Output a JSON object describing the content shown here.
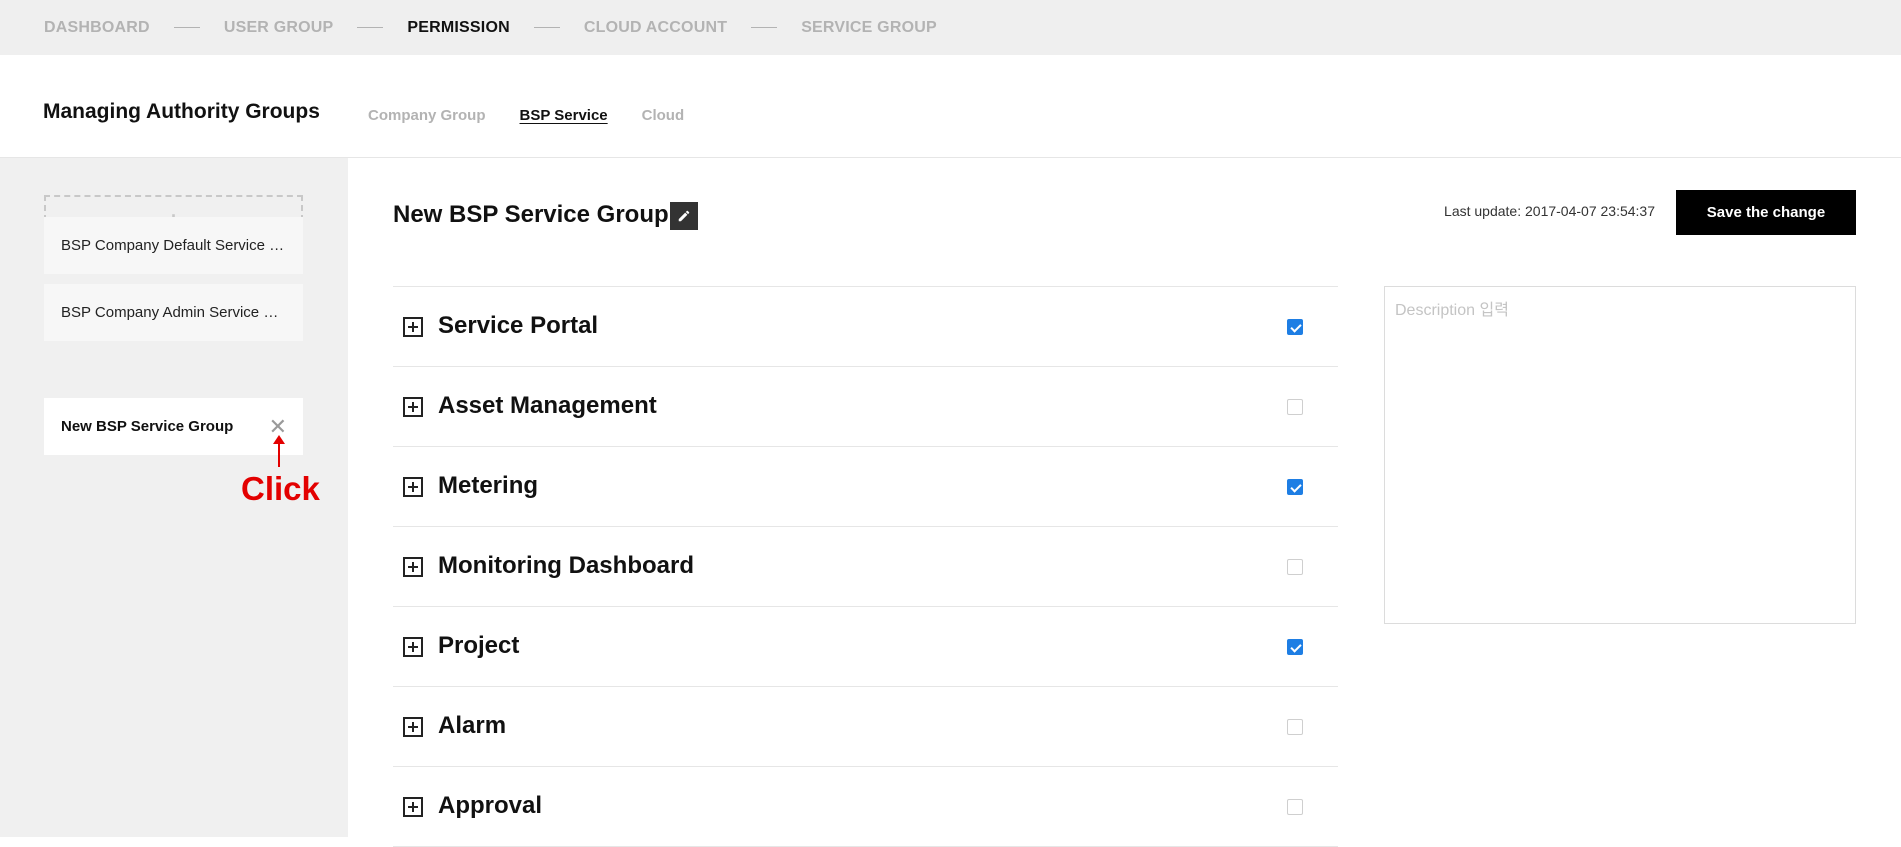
{
  "topnav": {
    "steps": [
      "DASHBOARD",
      "USER GROUP",
      "PERMISSION",
      "CLOUD ACCOUNT",
      "SERVICE GROUP"
    ],
    "active_step": "PERMISSION"
  },
  "header": {
    "title": "Managing Authority Groups",
    "subtabs": [
      "Company Group",
      "BSP Service",
      "Cloud"
    ],
    "active_subtab": "BSP Service"
  },
  "sidebar": {
    "add_icon": "plus-icon",
    "groups": [
      {
        "label": "BSP Company Default Service Group"
      },
      {
        "label": "BSP Company Admin Service Group"
      },
      {
        "label": "New BSP Service Group",
        "active": true
      }
    ],
    "close_icon": "close-icon"
  },
  "annotation": {
    "text": "Click",
    "color": "#e30000"
  },
  "main": {
    "title": "New BSP Service Group",
    "edit_icon": "pencil-icon",
    "last_update": "Last update: 2017-04-07 23:54:37",
    "save_label": "Save the change",
    "description_placeholder": "Description 입력",
    "permissions": [
      {
        "name": "Service Portal",
        "checked": true
      },
      {
        "name": "Asset Management",
        "checked": false
      },
      {
        "name": "Metering",
        "checked": true
      },
      {
        "name": "Monitoring Dashboard",
        "checked": false
      },
      {
        "name": "Project",
        "checked": true
      },
      {
        "name": "Alarm",
        "checked": false
      },
      {
        "name": "Approval",
        "checked": false
      }
    ]
  },
  "colors": {
    "accent_checkbox": "#1e7ee4",
    "primary_button": "#000000",
    "nav_bg": "#efefef",
    "sidebar_bg": "#f0f0f0"
  }
}
